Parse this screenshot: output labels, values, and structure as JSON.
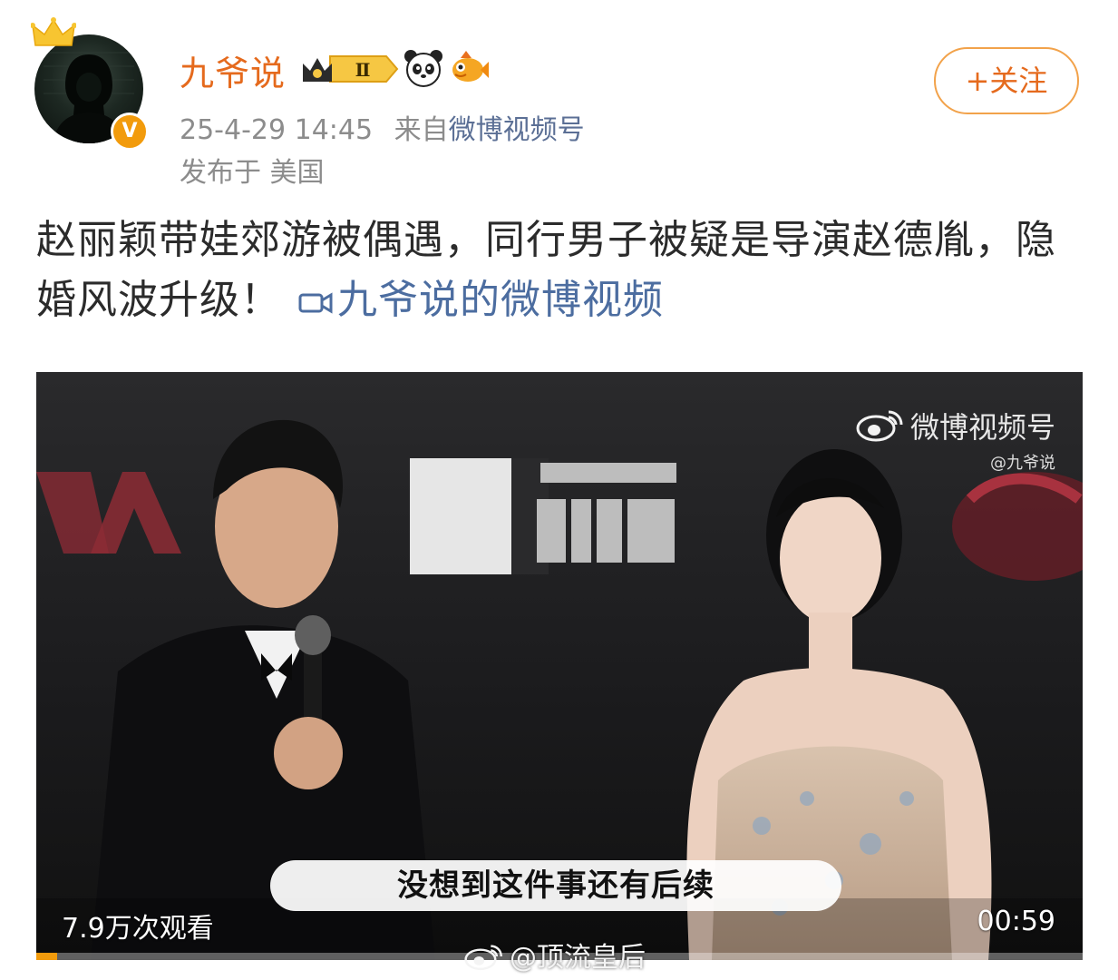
{
  "user": {
    "name": "九爷说",
    "level_badge": "Ⅱ",
    "verified_mark": "V"
  },
  "post_meta": {
    "time": "25-4-29 14:45",
    "from_label": "来自",
    "source": "微博视频号",
    "location": "发布于 美国"
  },
  "follow_button": {
    "label": "+关注"
  },
  "post": {
    "text": "赵丽颖带娃郊游被偶遇，同行男子被疑是导演赵德胤，隐婚风波升级！",
    "video_link": "九爷说的微博视频"
  },
  "video": {
    "watermark": "微博视频号",
    "watermark_handle": "@九爷说",
    "subtitle": "没想到这件事还有后续",
    "views": "7.9万次观看",
    "duration": "00:59",
    "progress": 0.02
  },
  "bottom_watermark": "@顶流皇后",
  "colors": {
    "accent": "#e56a1d",
    "link": "#4c6da0",
    "meta": "#8c8c8c",
    "badge": "#f29b0c"
  },
  "icons": [
    "crown-icon",
    "verified-icon",
    "level-badge-icon",
    "panda-icon",
    "fish-icon",
    "video-camera-icon",
    "weibo-logo-icon"
  ]
}
